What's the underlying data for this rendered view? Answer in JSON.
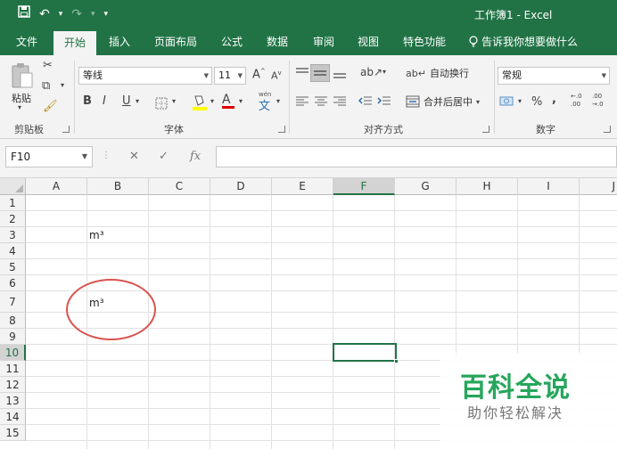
{
  "window": {
    "title": "工作簿1  -  Excel"
  },
  "qat": {
    "save_icon": "save-icon",
    "undo_icon": "undo-icon",
    "redo_icon": "redo-icon",
    "customize_icon": "chevron-down-icon"
  },
  "tabs": [
    {
      "label": "文件"
    },
    {
      "label": "开始"
    },
    {
      "label": "插入"
    },
    {
      "label": "页面布局"
    },
    {
      "label": "公式"
    },
    {
      "label": "数据"
    },
    {
      "label": "审阅"
    },
    {
      "label": "视图"
    },
    {
      "label": "特色功能"
    }
  ],
  "tell_me": {
    "label": "告诉我你想要做什么"
  },
  "ribbon": {
    "clipboard": {
      "paste_label": "粘贴",
      "group_label": "剪贴板"
    },
    "font": {
      "family": "等线",
      "size": "11",
      "group_label": "字体",
      "bold": "B",
      "italic": "I",
      "underline": "U",
      "grow": "A",
      "shrink": "A",
      "font_color": "A",
      "phonetic": "wén"
    },
    "alignment": {
      "wrap_text": "自动换行",
      "merge_center": "合并后居中",
      "group_label": "对齐方式"
    },
    "number": {
      "format": "常规",
      "percent": "%",
      "comma": ",",
      "inc_decimal": "←.0 .00",
      "dec_decimal": ".00 →.0",
      "group_label": "数字"
    }
  },
  "formula_bar": {
    "name_box": "F10",
    "cancel": "✕",
    "enter": "✓",
    "fx": "fx",
    "content": ""
  },
  "grid": {
    "columns": [
      "A",
      "B",
      "C",
      "D",
      "E",
      "F",
      "G",
      "H",
      "I",
      "J"
    ],
    "rows": [
      "1",
      "2",
      "3",
      "4",
      "5",
      "6",
      "7",
      "8",
      "9",
      "10",
      "11",
      "12",
      "13",
      "14",
      "15"
    ],
    "selected_cell": "F10",
    "cells": {
      "B3": "m³",
      "B7": "m³"
    }
  },
  "watermark": {
    "title": "百科全说",
    "subtitle": "助你轻松解决"
  },
  "colors": {
    "accent": "#217346",
    "annotation": "#d9534f",
    "watermark": "#26a65b"
  }
}
